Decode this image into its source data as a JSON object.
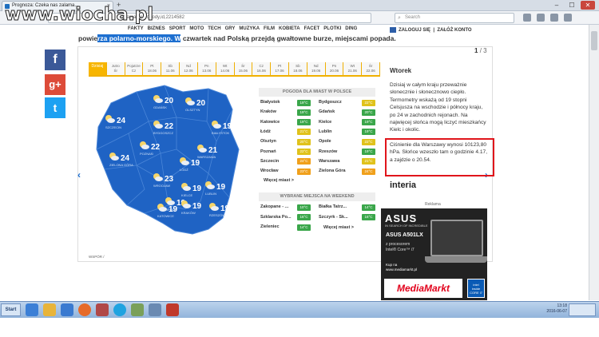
{
  "browser": {
    "tab_title": "Prognoza: Czeka nas zalama...",
    "new_tab": "+",
    "url": "zalamanie-pogody,id,2214582",
    "search_placeholder": "Search",
    "win_min": "–",
    "win_max": "☐",
    "win_close": "✕"
  },
  "watermark": "www.wiocha.pl",
  "site_nav": {
    "items": [
      "FAKTY",
      "BIZNES",
      "SPORT",
      "MOTO",
      "TECH",
      "GRY",
      "MUZYKA",
      "FILM",
      "KOBIETA",
      "FACET",
      "PLOTKI",
      "DING"
    ],
    "login": "ZALOGUJ SIĘ",
    "register": "ZAŁÓŻ KONTO"
  },
  "headline": {
    "prefix": "powie",
    "highlight": "rza polarno-morskiego. W",
    "suffix": " czwartek nad Polską przejdą gwałtowne burze, miejscami popada."
  },
  "pager": {
    "current": "1",
    "total": "/ 3"
  },
  "day_tabs": [
    {
      "l1": "Dzisiaj",
      "l2": ""
    },
    {
      "l1": "Jutro",
      "l2": "Śr"
    },
    {
      "l1": "Pojutrze",
      "l2": "Cz"
    },
    {
      "l1": "Pt",
      "l2": "18.06"
    },
    {
      "l1": "Sb",
      "l2": "11.06"
    },
    {
      "l1": "Nd",
      "l2": "12.06"
    },
    {
      "l1": "Pn",
      "l2": "13.06"
    },
    {
      "l1": "Wt",
      "l2": "14.06"
    },
    {
      "l1": "Śr",
      "l2": "15.06"
    },
    {
      "l1": "Cz",
      "l2": "16.06"
    },
    {
      "l1": "Pt",
      "l2": "17.06"
    },
    {
      "l1": "Sb",
      "l2": "18.06"
    },
    {
      "l1": "Nd",
      "l2": "19.06"
    },
    {
      "l1": "Pn",
      "l2": "20.06"
    },
    {
      "l1": "Wt",
      "l2": "21.06"
    },
    {
      "l1": "Śr",
      "l2": "22.06"
    }
  ],
  "map_cities": [
    {
      "name": "GDAŃSK",
      "temp": "20"
    },
    {
      "name": "OLSZTYN",
      "temp": "20"
    },
    {
      "name": "SZCZECIN",
      "temp": "24"
    },
    {
      "name": "BYDGOSZCZ",
      "temp": "22"
    },
    {
      "name": "BIAŁYSTOK",
      "temp": "19"
    },
    {
      "name": "POZNAŃ",
      "temp": "22"
    },
    {
      "name": "ZIELONA GÓRA",
      "temp": "24"
    },
    {
      "name": "ŁÓDŹ",
      "temp": "19"
    },
    {
      "name": "WARSZAWA",
      "temp": "21"
    },
    {
      "name": "WROCŁAW",
      "temp": "23"
    },
    {
      "name": "KIELCE",
      "temp": "19"
    },
    {
      "name": "LUBLIN",
      "temp": "19"
    },
    {
      "name": "OPOLE",
      "temp": "19"
    },
    {
      "name": "KATOWICE",
      "temp": "19"
    },
    {
      "name": "KRAKÓW",
      "temp": "19"
    },
    {
      "name": "RZESZÓW",
      "temp": "19"
    }
  ],
  "weather_cities": {
    "title": "POGODA DLA MIAST W POLSCE",
    "left": [
      {
        "name": "Białystok",
        "temp": "19°C",
        "color": "#3aa64a"
      },
      {
        "name": "Kraków",
        "temp": "19°C",
        "color": "#3aa64a"
      },
      {
        "name": "Katowice",
        "temp": "19°C",
        "color": "#3aa64a"
      },
      {
        "name": "Łódź",
        "temp": "21°C",
        "color": "#e0c21b"
      },
      {
        "name": "Olsztyn",
        "temp": "20°C",
        "color": "#e0c21b"
      },
      {
        "name": "Poznań",
        "temp": "22°C",
        "color": "#e0c21b"
      },
      {
        "name": "Szczecin",
        "temp": "24°C",
        "color": "#f0a01b"
      },
      {
        "name": "Wrocław",
        "temp": "23°C",
        "color": "#f0a01b"
      }
    ],
    "right": [
      {
        "name": "Bydgoszcz",
        "temp": "22°C",
        "color": "#e0c21b"
      },
      {
        "name": "Gdańsk",
        "temp": "20°C",
        "color": "#3aa64a"
      },
      {
        "name": "Kielce",
        "temp": "19°C",
        "color": "#3aa64a"
      },
      {
        "name": "Lublin",
        "temp": "19°C",
        "color": "#3aa64a"
      },
      {
        "name": "Opole",
        "temp": "22°C",
        "color": "#e0c21b"
      },
      {
        "name": "Rzeszów",
        "temp": "19°C",
        "color": "#3aa64a"
      },
      {
        "name": "Warszawa",
        "temp": "21°C",
        "color": "#e0c21b"
      },
      {
        "name": "Zielona Góra",
        "temp": "24°C",
        "color": "#f0a01b"
      }
    ],
    "more": "Więcej miast >"
  },
  "weekend": {
    "title": "WYBRANE MIEJSCA NA WEEKEND",
    "left": [
      {
        "name": "Zakopane - ...",
        "temp": "10°C",
        "color": "#3aa64a"
      },
      {
        "name": "Szklarska Po...",
        "temp": "16°C",
        "color": "#3aa64a"
      },
      {
        "name": "Zieleniec",
        "temp": "14°C",
        "color": "#3aa64a"
      }
    ],
    "right": [
      {
        "name": "Białka Tatrz...",
        "temp": "14°C",
        "color": "#3aa64a"
      },
      {
        "name": "Szczyrk - Sk...",
        "temp": "16°C",
        "color": "#3aa64a"
      }
    ],
    "more": "Więcej miast >"
  },
  "forecast": {
    "day": "Wtorek",
    "description": "Dzisiaj w całym kraju przeważnie słonecznie i słonecznowo ciepło. Termometry wskażą od 19 stopni Celsjusza na wschodzie i północy kraju, po 24 w zachodnich rejonach. Na najwięcej słońca mogą liczyć mieszkańcy Kielc i okolic.",
    "pressure": "Ciśnienie dla Warszawy wynosi 10123,80 hPa. Słońce wzeszło tam o godzinie 4.17, a zajdzie o 20.54."
  },
  "interia": {
    "logo": "interia",
    "reklama": "Reklama"
  },
  "ad": {
    "brand": "ASUS",
    "tagline": "IN SEARCH OF INCREDIBLE",
    "model": "ASUS A501LX",
    "proc1": "z procesorem",
    "proc2": "Intel® Core™ i7",
    "kup1": "Kup na",
    "kup2": "www.mediamarkt.pl",
    "store": "MediaMarkt",
    "intel1": "intel",
    "intel2": "inside",
    "intel3": "CORE i7"
  },
  "breadcrumb": "WSPÓR   /",
  "taskbar": {
    "start": "Start",
    "time": "13:18",
    "date": "2016-06-07",
    "show": ""
  },
  "arrows": {
    "left": "‹",
    "right": "›"
  },
  "social": {
    "fb": "f",
    "gp": "g+",
    "tw": "t"
  }
}
